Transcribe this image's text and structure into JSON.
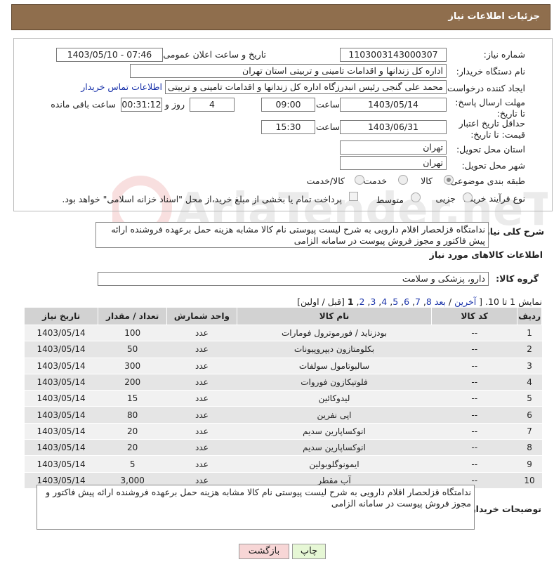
{
  "header": {
    "title": "جزئیات اطلاعات نیاز"
  },
  "fields": {
    "need_number_label": "شماره نیاز:",
    "need_number": "1103003143000307",
    "announce_label": "تاریخ و ساعت اعلان عمومی:",
    "announce_value": "1403/05/10 - 07:46",
    "buyer_org_label": "نام دستگاه خریدار:",
    "buyer_org": "اداره کل زندانها و اقدامات تامینی و تربیتی استان تهران",
    "requester_label": "ایجاد کننده درخواست:",
    "requester": "محمد علی گنجی رئیس انبدرزگاه  اداره کل زندانها و اقدامات تامینی و تربیتی است",
    "contact_link": "اطلاعات تماس خریدار",
    "deadline_label": "مهلت ارسال پاسخ: تا تاریخ:",
    "deadline_date": "1403/05/14",
    "hour_label": "ساعت",
    "deadline_hour": "09:00",
    "days_value": "4",
    "days_label": "روز و",
    "remaining_time": "00:31:12",
    "remaining_label": "ساعت باقی مانده",
    "validity_label": "حداقل تاریخ اعتبار قیمت: تا تاریخ:",
    "validity_date": "1403/06/31",
    "validity_hour": "15:30",
    "province_label": "استان محل تحویل:",
    "province": "تهران",
    "city_label": "شهر محل تحویل:",
    "city": "تهران",
    "category_label": "طبقه بندی موضوعی:",
    "category_options": [
      "کالا",
      "خدمت",
      "کالا/خدمت"
    ],
    "process_label": "نوع فرآیند خرید :",
    "process_options": [
      "جزیی",
      "متوسط"
    ],
    "payment_note": "پرداخت تمام یا بخشی از مبلغ خرید،از محل \"اسناد خزانه اسلامی\" خواهد بود."
  },
  "summary": {
    "label": "شرح کلی نیاز:",
    "text": "ندامتگاه قزلحصار اقلام دارویی به شرح لیست پیوستی نام کالا مشابه هزینه حمل برعهده فروشنده ارائه پیش فاکتور و مجوز فروش پیوست در سامانه الزامی"
  },
  "goods": {
    "section_title": "اطلاعات کالاهای مورد نیاز",
    "group_label": "گروه کالا:",
    "group_value": "دارو، پزشکی و سلامت",
    "pagination": {
      "showing": "نمایش 1 تا 10.",
      "last": "آخرین",
      "next": "بعد",
      "pages": [
        "8",
        "7",
        "6",
        "5",
        "4",
        "3",
        "2"
      ],
      "current": "1",
      "prev_first": "[قبل / اولین]"
    },
    "columns": [
      "ردیف",
      "کد کالا",
      "نام کالا",
      "واحد شمارش",
      "تعداد / مقدار",
      "تاریخ نیاز"
    ],
    "rows": [
      [
        "1",
        "--",
        "بودزناید / فورموترول فومارات",
        "عدد",
        "100",
        "1403/05/14"
      ],
      [
        "2",
        "--",
        "بکلومتازون دیپروپیونات",
        "عدد",
        "50",
        "1403/05/14"
      ],
      [
        "3",
        "--",
        "سالبوتامول سولفات",
        "عدد",
        "300",
        "1403/05/14"
      ],
      [
        "4",
        "--",
        "فلوتیکازون فوروات",
        "عدد",
        "200",
        "1403/05/14"
      ],
      [
        "5",
        "--",
        "لیدوکائین",
        "عدد",
        "15",
        "1403/05/14"
      ],
      [
        "6",
        "--",
        "اپی نفرین",
        "عدد",
        "80",
        "1403/05/14"
      ],
      [
        "7",
        "--",
        "انوکساپارین سدیم",
        "عدد",
        "20",
        "1403/05/14"
      ],
      [
        "8",
        "--",
        "انوکساپارین سدیم",
        "عدد",
        "20",
        "1403/05/14"
      ],
      [
        "9",
        "--",
        "ایمونوگلوبولین",
        "عدد",
        "5",
        "1403/05/14"
      ],
      [
        "10",
        "--",
        "آب مقطر",
        "عدد",
        "3,000",
        "1403/05/14"
      ]
    ]
  },
  "buyer_notes": {
    "label": "توضیحات خریدار:",
    "text": "ندامتگاه قزلحصار اقلام دارویی به شرح لیست پیوستی نام کالا مشابه هزینه حمل برعهده فروشنده ارائه پیش فاکتور و مجوز فروش پیوست در سامانه الزامی"
  },
  "buttons": {
    "print": "چاپ",
    "back": "بازگشت"
  },
  "watermark_text": "AriaTender.neT",
  "colors": {
    "header": "#8f6e4d",
    "print_button": "#e6f7d5",
    "back_button": "#f7d6d6",
    "link": "#1a33aa"
  }
}
